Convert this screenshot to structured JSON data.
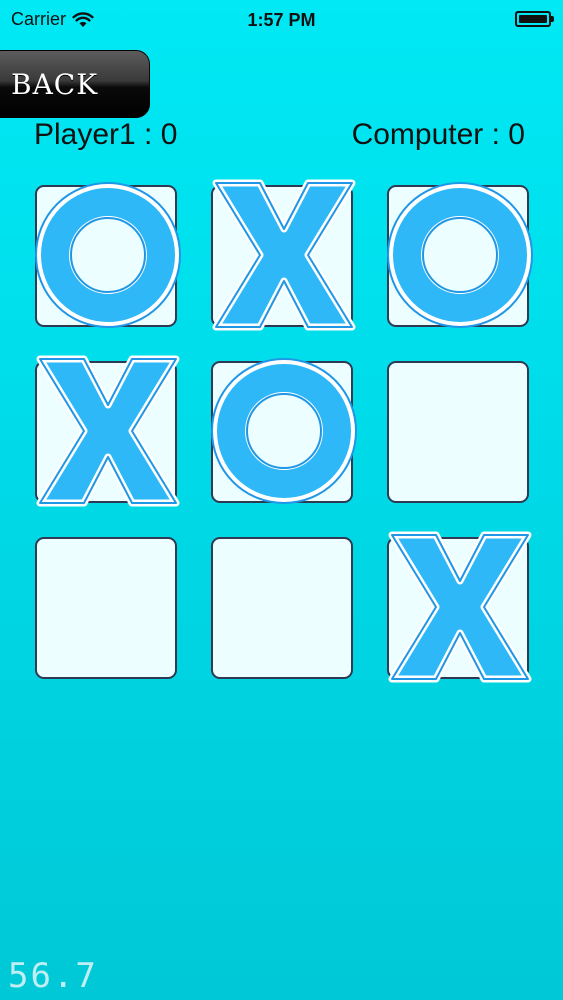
{
  "status_bar": {
    "carrier": "Carrier",
    "time": "1:57 PM",
    "icons": [
      "wifi-icon",
      "battery-icon"
    ]
  },
  "back_button": {
    "label": "BACK"
  },
  "scores": {
    "player_label": "Player1  : 0",
    "computer_label": "Computer : 0"
  },
  "board": {
    "cells": [
      "O",
      "X",
      "O",
      "X",
      "O",
      "",
      "",
      "",
      "X"
    ]
  },
  "fps": "56.7",
  "colors": {
    "background_top": "#00e9f4",
    "background_bottom": "#00c8d6",
    "mark_fill": "#2fb8f7",
    "cell_fill": "#ecfeff",
    "cell_border": "#2d3a52"
  }
}
